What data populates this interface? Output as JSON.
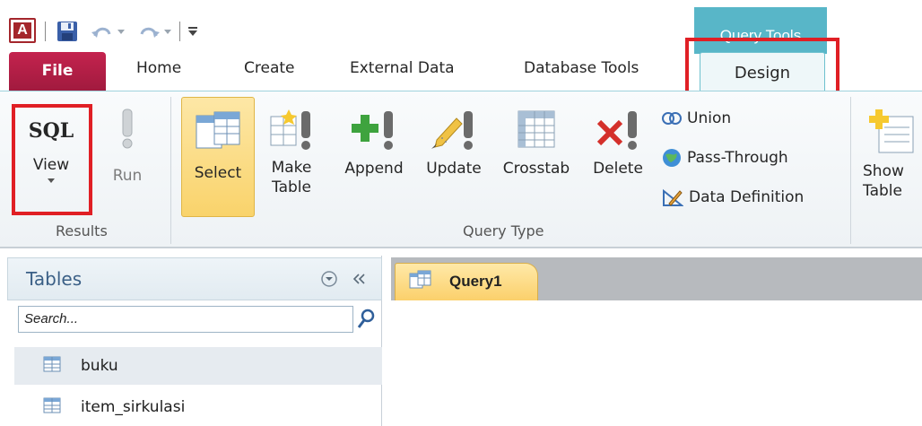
{
  "quick_access": {
    "app_logo_letter": "A",
    "icons": [
      "access-logo-icon",
      "save-icon",
      "undo-icon",
      "redo-icon",
      "customize-qat-icon"
    ]
  },
  "contextual": {
    "title": "Query Tools"
  },
  "tabs": {
    "file": "File",
    "home": "Home",
    "create": "Create",
    "external_data": "External Data",
    "database_tools": "Database Tools",
    "design": "Design"
  },
  "ribbon": {
    "results": {
      "label": "Results",
      "view": {
        "icon_text": "SQL",
        "label": "View"
      },
      "run": {
        "label": "Run"
      }
    },
    "query_type": {
      "label": "Query Type",
      "select": "Select",
      "make_table_line1": "Make",
      "make_table_line2": "Table",
      "append": "Append",
      "update": "Update",
      "crosstab": "Crosstab",
      "delete": "Delete",
      "union": "Union",
      "pass_through": "Pass-Through",
      "data_definition": "Data Definition"
    },
    "query_setup": {
      "show_table_line1": "Show",
      "show_table_line2": "Table"
    }
  },
  "nav_pane": {
    "title": "Tables",
    "search_placeholder": "Search...",
    "items": [
      {
        "label": "buku"
      },
      {
        "label": "item_sirkulasi"
      }
    ]
  },
  "document": {
    "tab_label": "Query1"
  },
  "colors": {
    "file_tab": "#b61f45",
    "contextual_header": "#58b6c8",
    "highlight_box": "#e01f25",
    "selected_button": "#f9d36b"
  }
}
